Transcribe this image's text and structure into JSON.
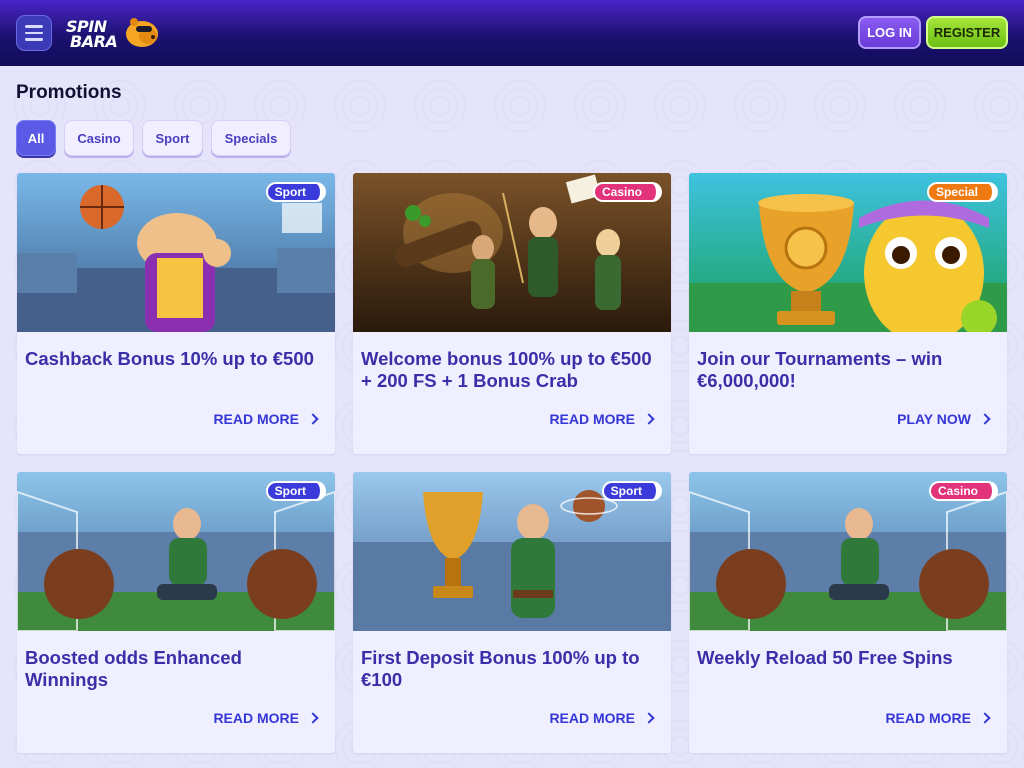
{
  "header": {
    "logo_line1": "SPIN",
    "logo_line2": "BARA",
    "login_label": "LOG IN",
    "register_label": "REGISTER"
  },
  "page": {
    "title": "Promotions"
  },
  "filters": [
    {
      "label": "All",
      "active": true
    },
    {
      "label": "Casino",
      "active": false
    },
    {
      "label": "Sport",
      "active": false
    },
    {
      "label": "Specials",
      "active": false
    }
  ],
  "cards": [
    {
      "badge": "Sport",
      "badge_color": "#3b3bdc",
      "title": "Cashback Bonus 10% up to €500",
      "cta": "READ MORE",
      "image": "basketball-player"
    },
    {
      "badge": "Casino",
      "badge_color": "#e2327a",
      "title": "Welcome bonus 100% up to €500 + 200 FS + 1 Bonus Crab",
      "cta": "READ MORE",
      "image": "archers-tavern"
    },
    {
      "badge": "Special",
      "badge_color": "#f07a12",
      "title": "Join our Tournaments – win €6,000,000!",
      "cta": "PLAY NOW",
      "image": "trophy-mascot"
    },
    {
      "badge": "Sport",
      "badge_color": "#3b3bdc",
      "title": "Boosted odds Enhanced Winnings",
      "cta": "READ MORE",
      "image": "football-player"
    },
    {
      "badge": "Sport",
      "badge_color": "#3b3bdc",
      "title": "First Deposit Bonus 100% up to €100",
      "cta": "READ MORE",
      "image": "trophy-player"
    },
    {
      "badge": "Casino",
      "badge_color": "#e2327a",
      "title": "Weekly Reload 50 Free Spins",
      "cta": "READ MORE",
      "image": "football-player"
    }
  ]
}
